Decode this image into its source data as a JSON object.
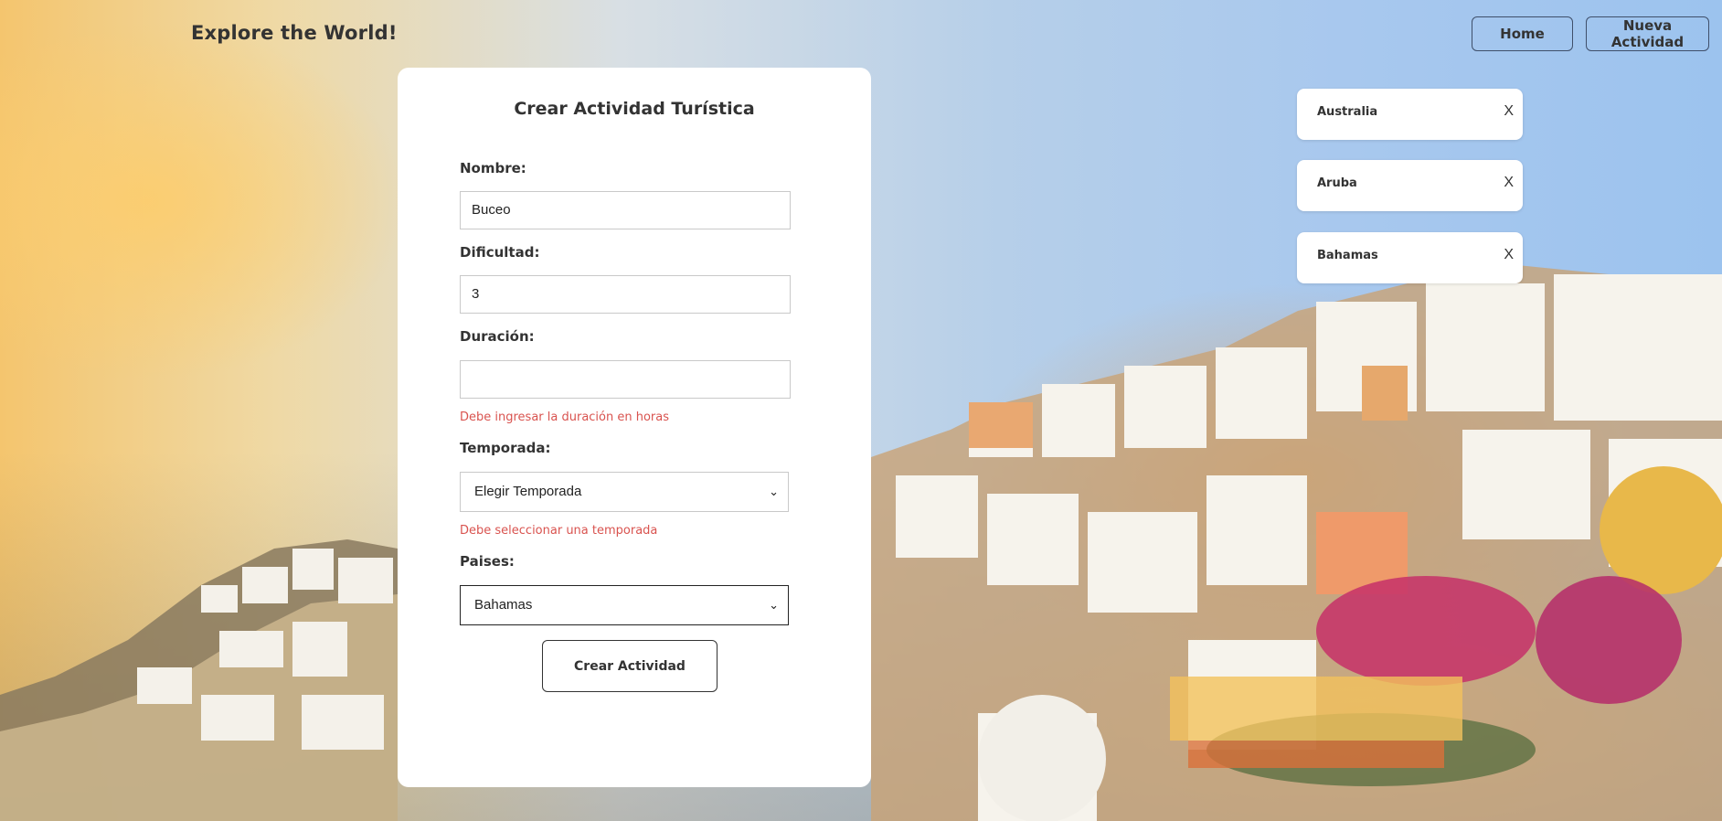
{
  "header": {
    "brand": "Explore the World!",
    "nav": [
      {
        "label": "Home"
      },
      {
        "label": "Nueva Actividad"
      }
    ]
  },
  "form": {
    "title": "Crear Actividad Turística",
    "nombre": {
      "label": "Nombre:",
      "value": "Buceo"
    },
    "dificultad": {
      "label": "Dificultad:",
      "value": "3"
    },
    "duracion": {
      "label": "Duración:",
      "value": "",
      "error": "Debe ingresar la duración en horas"
    },
    "temporada": {
      "label": "Temporada:",
      "selected": "Elegir Temporada",
      "error": "Debe seleccionar una temporada"
    },
    "paises": {
      "label": "Paises:",
      "selected": "Bahamas"
    },
    "submit_label": "Crear Actividad"
  },
  "selected_countries": [
    {
      "name": "Australia",
      "remove": "X"
    },
    {
      "name": "Aruba",
      "remove": "X"
    },
    {
      "name": "Bahamas",
      "remove": "X"
    }
  ],
  "colors": {
    "error": "#d9534f",
    "card": "#ffffff",
    "nav_border": "#3f4f6a"
  }
}
